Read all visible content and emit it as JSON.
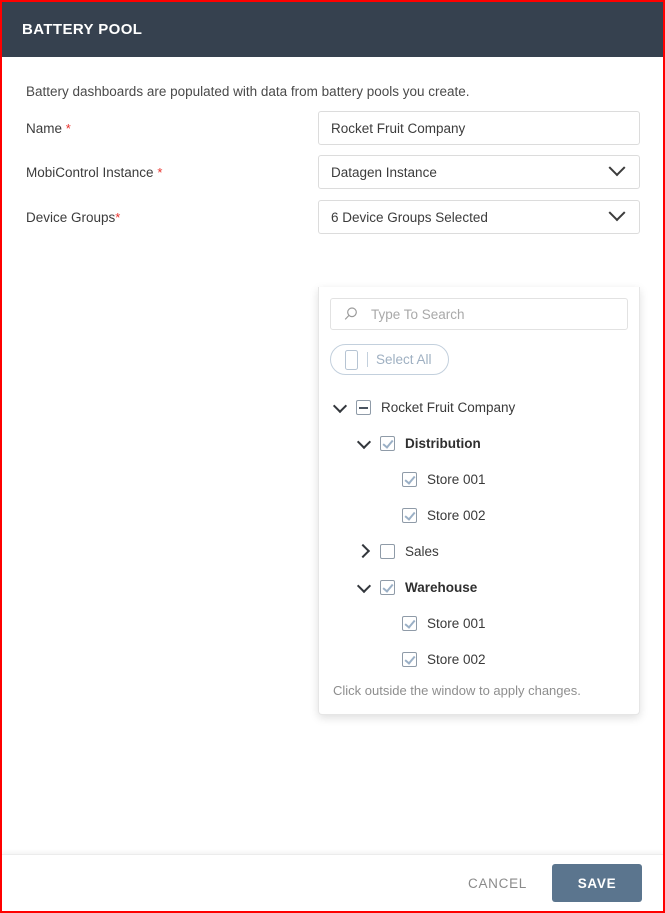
{
  "window": {
    "title": "BATTERY POOL",
    "header_color": "#36414f",
    "border_color": "#ff0000"
  },
  "form": {
    "intro": "Battery dashboards are populated with data from battery pools you create.",
    "required_mark": "*",
    "fields": {
      "name": {
        "label": "Name ",
        "value": "Rocket Fruit Company"
      },
      "instance": {
        "label": "MobiControl Instance ",
        "value": "Datagen Instance"
      },
      "device_groups": {
        "label": "Device Groups",
        "value": "6 Device Groups Selected"
      }
    }
  },
  "dropdown": {
    "search_placeholder": "Type To Search",
    "search_value": "",
    "select_all_label": "Select All",
    "hint": "Click outside the window to apply changes.",
    "tree": [
      {
        "label": "Rocket Fruit Company",
        "level": 0,
        "twist": "down",
        "check": "indet",
        "bold": false
      },
      {
        "label": "Distribution",
        "level": 1,
        "twist": "down",
        "check": "checked",
        "bold": true
      },
      {
        "label": "Store 001",
        "level": 2,
        "twist": "none",
        "check": "checked",
        "bold": false
      },
      {
        "label": "Store 002",
        "level": 2,
        "twist": "none",
        "check": "checked",
        "bold": false
      },
      {
        "label": "Sales",
        "level": 1,
        "twist": "right",
        "check": "unchecked",
        "bold": false
      },
      {
        "label": "Warehouse",
        "level": 1,
        "twist": "down",
        "check": "checked",
        "bold": true
      },
      {
        "label": "Store 001",
        "level": 2,
        "twist": "none",
        "check": "checked",
        "bold": false
      },
      {
        "label": "Store 002",
        "level": 2,
        "twist": "none",
        "check": "checked",
        "bold": false
      }
    ]
  },
  "footer": {
    "cancel_label": "CANCEL",
    "save_label": "SAVE",
    "save_color": "#5b758e"
  }
}
